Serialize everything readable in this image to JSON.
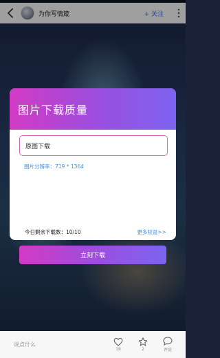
{
  "header": {
    "title": "为你写情箴",
    "follow_label": "+ 关注"
  },
  "dialog": {
    "title": "图片下载质量",
    "option_label": "原图下载",
    "resolution_text": "图片分辨率：719 * 1364",
    "quota_text": "今日剩余下载数：10/10",
    "more_rights_label": "更多权益>>"
  },
  "download_button": {
    "label": "立刻下载"
  },
  "bottom": {
    "comment_placeholder": "说点什么",
    "like_count": "18",
    "favorite_count": "2",
    "comment_label": "评论"
  },
  "colors": {
    "accent_start": "#d23bc4",
    "accent_end": "#7d63f0",
    "link": "#3f8fe0",
    "follow": "#2f7ae5"
  },
  "icons": [
    "back-icon",
    "more-icon",
    "heart-icon",
    "star-icon",
    "comment-icon"
  ]
}
